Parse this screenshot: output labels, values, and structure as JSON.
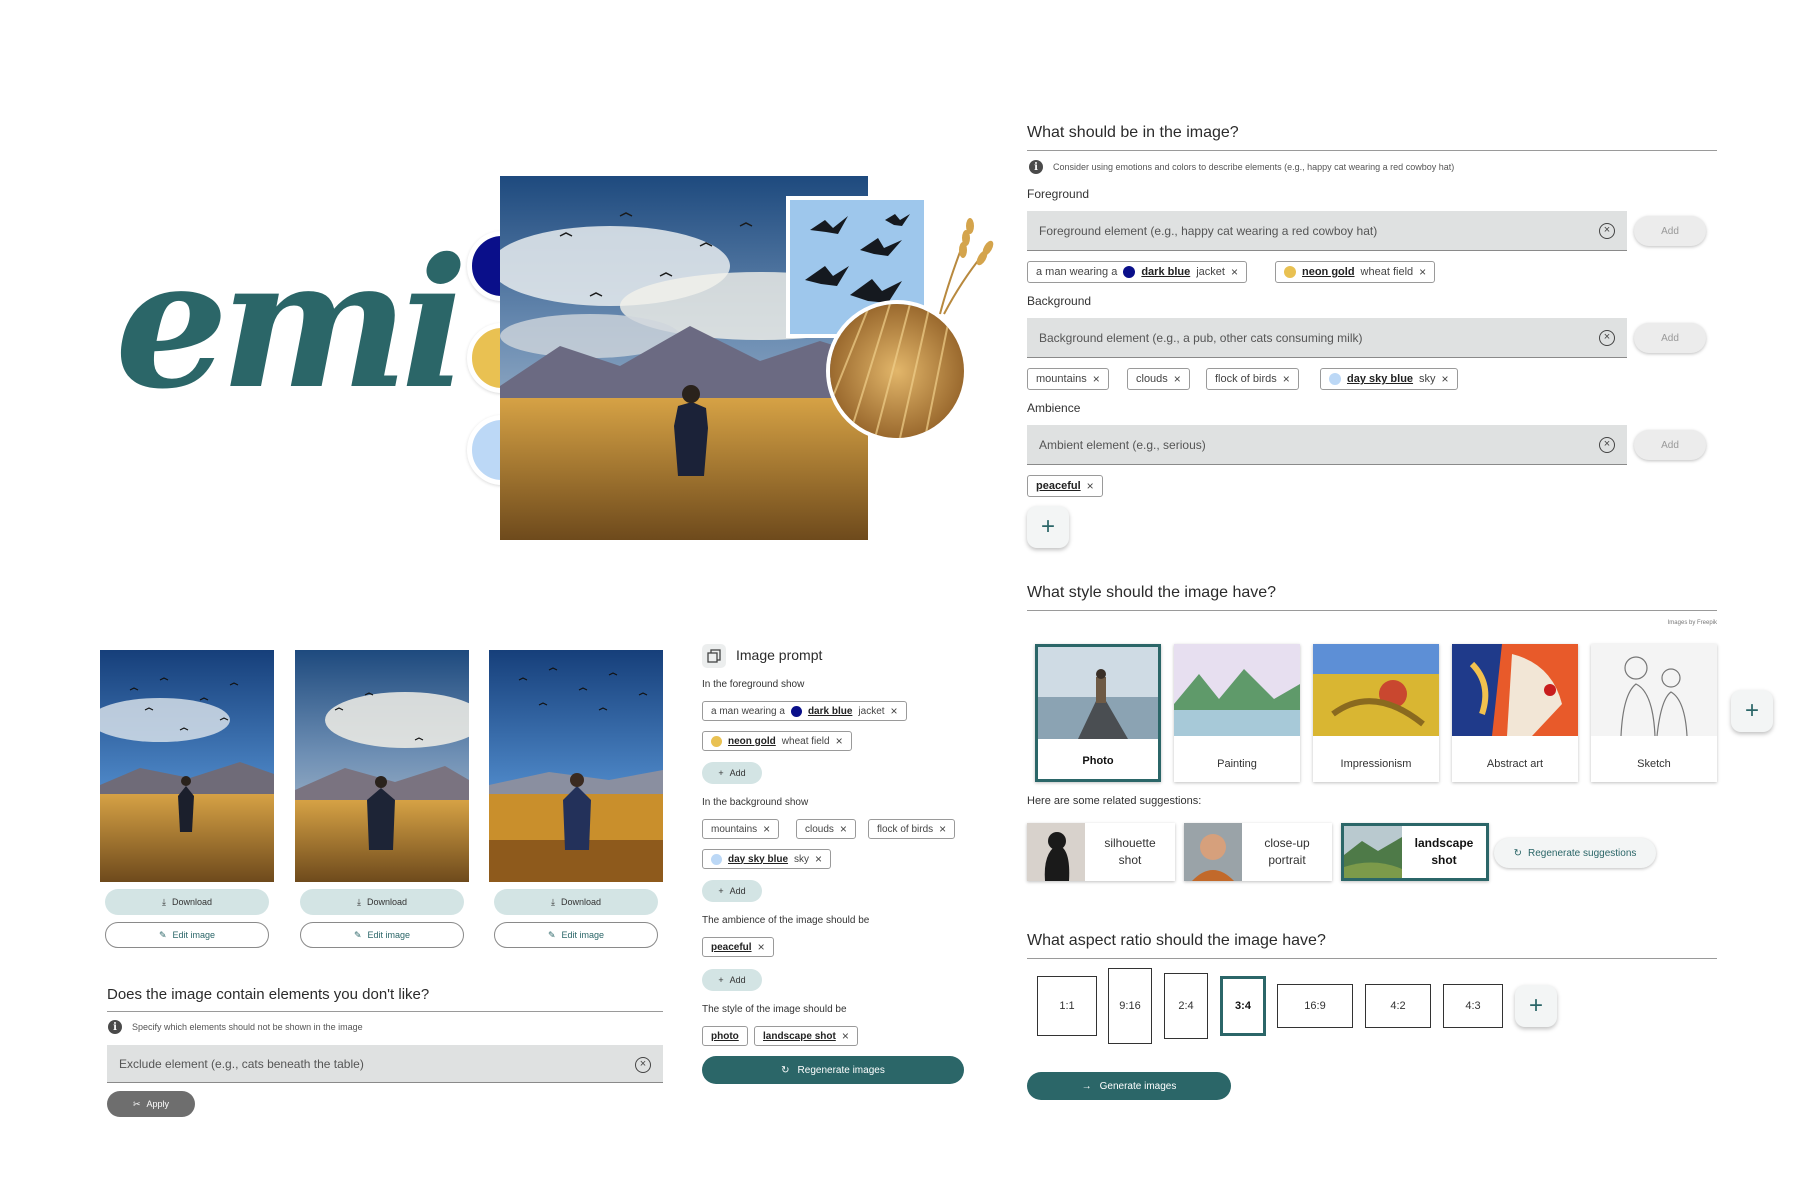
{
  "brand": {
    "logo_text": "emi"
  },
  "colors": {
    "accent": "#2b6668",
    "dark_blue": "#0a0f8a",
    "neon_gold": "#e9c152",
    "day_sky_blue": "#bcd8f6",
    "chip_light": "#d3e4e4"
  },
  "content": {
    "title": "What should be in the image?",
    "hint": "Consider using emotions and colors to describe elements (e.g., happy cat wearing a red cowboy hat)",
    "foreground": {
      "label": "Foreground",
      "placeholder": "Foreground element (e.g., happy cat wearing a red cowboy hat)",
      "add": "Add",
      "chip1": {
        "pre": "a man wearing a",
        "color": "dark blue",
        "post": "jacket"
      },
      "chip2": {
        "color": "neon gold",
        "post": "wheat field"
      }
    },
    "background": {
      "label": "Background",
      "placeholder": "Background element (e.g., a pub, other cats consuming milk)",
      "add": "Add",
      "chips": [
        "mountains",
        "clouds",
        "flock of birds"
      ],
      "chip_color": {
        "color": "day sky blue",
        "post": "sky"
      }
    },
    "ambience": {
      "label": "Ambience",
      "placeholder": "Ambient element (e.g., serious)",
      "add": "Add",
      "chip": "peaceful"
    }
  },
  "style": {
    "title": "What style should the image have?",
    "credit": "Images by Freepik",
    "options": [
      "Photo",
      "Painting",
      "Impressionism",
      "Abstract art",
      "Sketch"
    ],
    "selected": "Photo",
    "suggestions_label": "Here are some related suggestions:",
    "suggestions": [
      {
        "line1": "silhouette",
        "line2": "shot"
      },
      {
        "line1": "close-up",
        "line2": "portrait"
      },
      {
        "line1": "landscape",
        "line2": "shot"
      }
    ],
    "regenerate": "Regenerate suggestions"
  },
  "aspect": {
    "title": "What aspect ratio should the image have?",
    "options": [
      "1:1",
      "9:16",
      "2:4",
      "3:4",
      "16:9",
      "4:2",
      "4:3"
    ],
    "selected": "3:4"
  },
  "generate": "Generate images",
  "results": {
    "download": "Download",
    "edit": "Edit image"
  },
  "exclude": {
    "title": "Does the image contain elements you don't like?",
    "hint": "Specify which elements should not be shown in the image",
    "placeholder": "Exclude element (e.g., cats beneath the table)",
    "apply": "Apply"
  },
  "prompt": {
    "title": "Image prompt",
    "fg_label": "In the foreground show",
    "fg_chip1": {
      "pre": "a man wearing a",
      "color": "dark blue",
      "post": "jacket"
    },
    "fg_chip2": {
      "color": "neon gold",
      "post": "wheat field"
    },
    "add": "Add",
    "bg_label": "In the background show",
    "bg_chips": [
      "mountains",
      "clouds",
      "flock of birds"
    ],
    "bg_color_chip": {
      "color": "day sky blue",
      "post": "sky"
    },
    "amb_label": "The ambience of the image should be",
    "amb_chip": "peaceful",
    "style_label": "The style of the image should be",
    "style_chips": [
      "photo",
      "landscape shot"
    ],
    "regenerate": "Regenerate images"
  }
}
